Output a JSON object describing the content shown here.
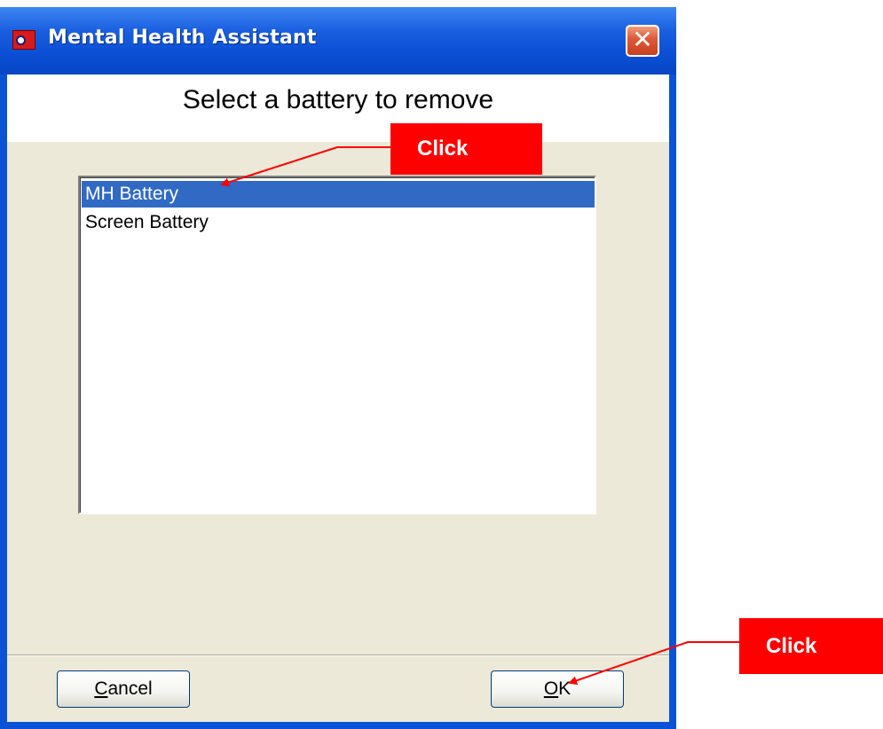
{
  "window": {
    "title": "Mental Health Assistant",
    "close_glyph": "✕"
  },
  "dialog": {
    "heading": "Select a battery to remove",
    "list": {
      "items": [
        {
          "label": "MH Battery",
          "selected": true
        },
        {
          "label": "Screen Battery",
          "selected": false
        }
      ]
    },
    "buttons": {
      "cancel": {
        "accel": "C",
        "rest": "ancel"
      },
      "ok": {
        "accel": "O",
        "rest": "K"
      }
    }
  },
  "annotations": {
    "callout_list": "Click",
    "callout_ok": "Click",
    "color": "#ff0000"
  },
  "colors": {
    "titlebar": "#0a4fd4",
    "selection": "#316ac5",
    "dialog_bg": "#ece9d8"
  },
  "icons": {
    "app": "app-logo-icon",
    "close": "close-icon"
  }
}
